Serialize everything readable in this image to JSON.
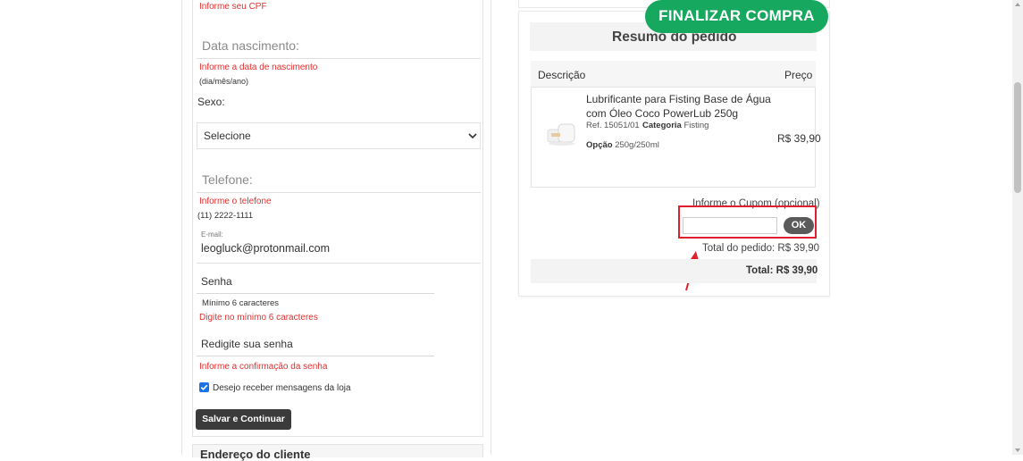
{
  "customer_form": {
    "cpf_error": "Informe seu CPF",
    "birthdate_placeholder": "Data nascimento:",
    "birthdate_error": "Informe a data de nascimento",
    "birthdate_hint": "(dia/mês/ano)",
    "sex_label": "Sexo:",
    "sex_select_value": "Selecione",
    "phone_placeholder": "Telefone:",
    "phone_error": "Informe o telefone",
    "phone_hint": "(11) 2222-1111",
    "email_label": "E-mail:",
    "email_value": "leogluck@protonmail.com",
    "password_placeholder": "Senha",
    "password_hint": "Mínimo 6 caracteres",
    "password_error": "Digite no mínimo 6 caracteres",
    "password_confirm_placeholder": "Redigite sua senha",
    "password_confirm_error": "Informe a confirmação da senha",
    "newsletter_label": "Desejo receber mensagens da loja",
    "newsletter_checked": true,
    "save_button": "Salvar e Continuar"
  },
  "address_section": {
    "title": "Endereço do cliente"
  },
  "finalize_button": "FINALIZAR COMPRA",
  "order_summary": {
    "title": "Resumo do pedido",
    "col_description": "Descrição",
    "col_price": "Preço",
    "item": {
      "name": "Lubrificante para Fisting Base de Água com Óleo Coco PowerLub 250g",
      "ref_label": "Ref. 15051/01",
      "category_label": "Categoria",
      "category_value": "Fisting",
      "option_label": "Opção",
      "option_value": "250g/250ml",
      "price": "R$ 39,90"
    },
    "coupon_label": "Informe o Cupom (opcional)",
    "coupon_value": "",
    "ok_button": "OK",
    "subtotal_label": "Total do pedido:",
    "subtotal_value": "R$ 39,90",
    "total_label": "Total:",
    "total_value": "R$ 39,90"
  },
  "colors": {
    "finalize_bg": "#16a85f",
    "error_text": "#e0302f",
    "highlight_box": "#e0202e"
  }
}
